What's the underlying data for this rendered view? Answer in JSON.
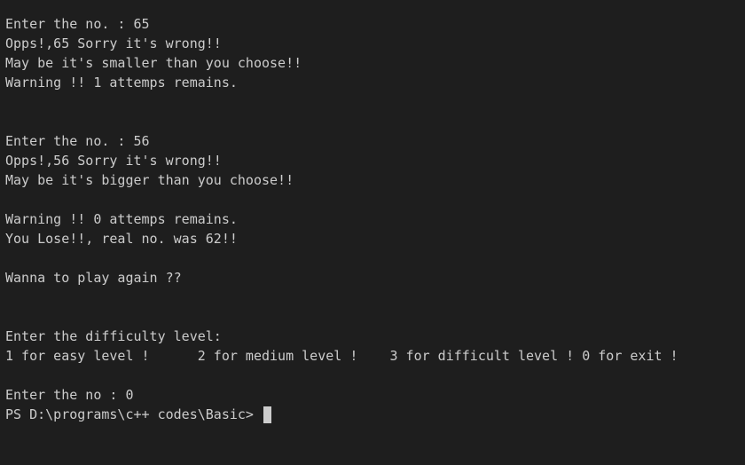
{
  "terminal": {
    "lines": [
      "Enter the no. : 65",
      "Opps!,65 Sorry it's wrong!!",
      "May be it's smaller than you choose!!",
      "Warning !! 1 attemps remains.",
      "",
      "",
      "Enter the no. : 56",
      "Opps!,56 Sorry it's wrong!!",
      "May be it's bigger than you choose!!",
      "",
      "Warning !! 0 attemps remains.",
      "You Lose!!, real no. was 62!!",
      "",
      "Wanna to play again ??",
      "",
      "",
      "Enter the difficulty level:",
      "1 for easy level !      2 for medium level !    3 for difficult level ! 0 for exit !",
      "",
      "Enter the no : 0"
    ],
    "prompt": "PS D:\\programs\\c++ codes\\Basic> "
  },
  "colors": {
    "background": "#1e1e1e",
    "foreground": "#cccccc",
    "cursor": "#cccccc"
  }
}
